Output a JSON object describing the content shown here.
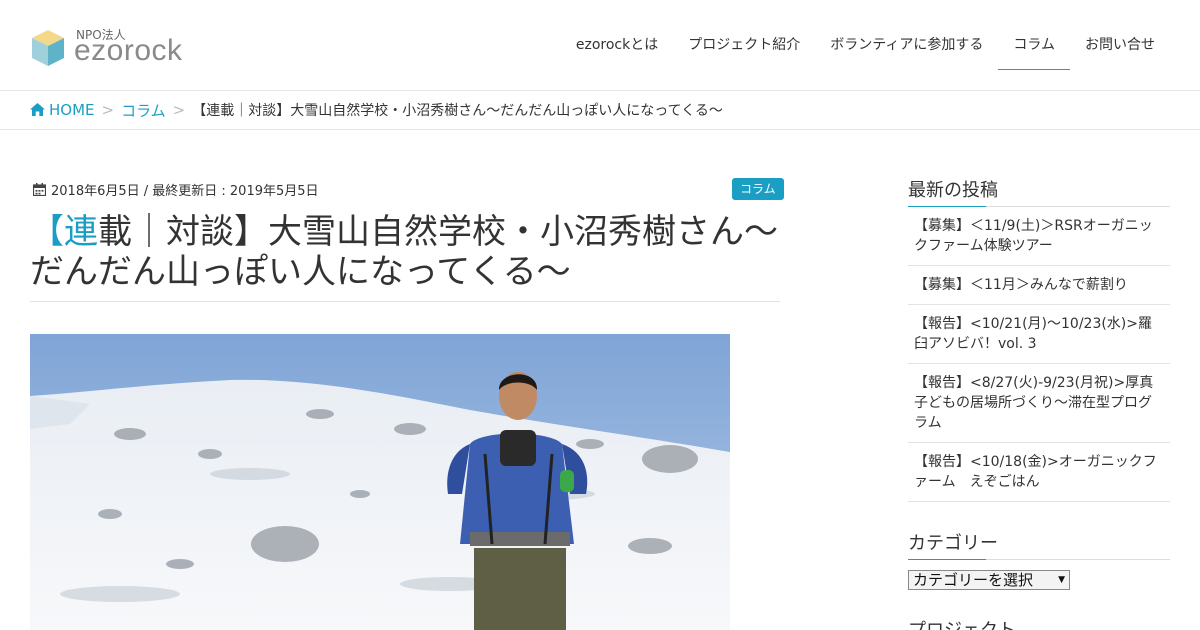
{
  "logo": {
    "org_type": "NPO法人",
    "name": "ezorock"
  },
  "nav": {
    "items": [
      {
        "label": "ezorockとは"
      },
      {
        "label": "プロジェクト紹介"
      },
      {
        "label": "ボランティアに参加する"
      },
      {
        "label": "コラム"
      },
      {
        "label": "お問い合せ"
      }
    ],
    "active_index": 3
  },
  "breadcrumb": {
    "home": "HOME",
    "separator": ">",
    "category": "コラム",
    "current": "【連載｜対談】大雪山自然学校・小沼秀樹さん～だんだん山っぽい人になってくる～"
  },
  "post": {
    "date_line": "2018年6月5日 / 最終更新日 : 2019年5月5日",
    "category_badge": "コラム",
    "title_accent": "【連",
    "title_rest": "載｜対談】大雪山自然学校・小沼秀樹さん～だんだん山っぽい人になってくる～"
  },
  "sidebar": {
    "recent_heading": "最新の投稿",
    "recent_posts": [
      "【募集】＜11/9(土)＞RSRオーガニックファーム体験ツアー",
      "【募集】＜11月＞みんなで薪割り",
      "【報告】<10/21(月)～10/23(水)>羅臼アソビバ！vol. 3",
      "【報告】<8/27(火)-9/23(月祝)>厚真子どもの居場所づくり～滞在型プログラム",
      "【報告】<10/18(金)>オーガニックファーム　えぞごはん"
    ],
    "category_heading": "カテゴリー",
    "category_select": "カテゴリーを選択",
    "project_heading": "プロジェクト"
  },
  "colors": {
    "accent": "#1b9ec4",
    "text": "#333333",
    "border": "#e3e3e3"
  },
  "icons": {
    "home": "home-icon",
    "date": "calendar-icon",
    "logo": "cube-logo-icon"
  }
}
